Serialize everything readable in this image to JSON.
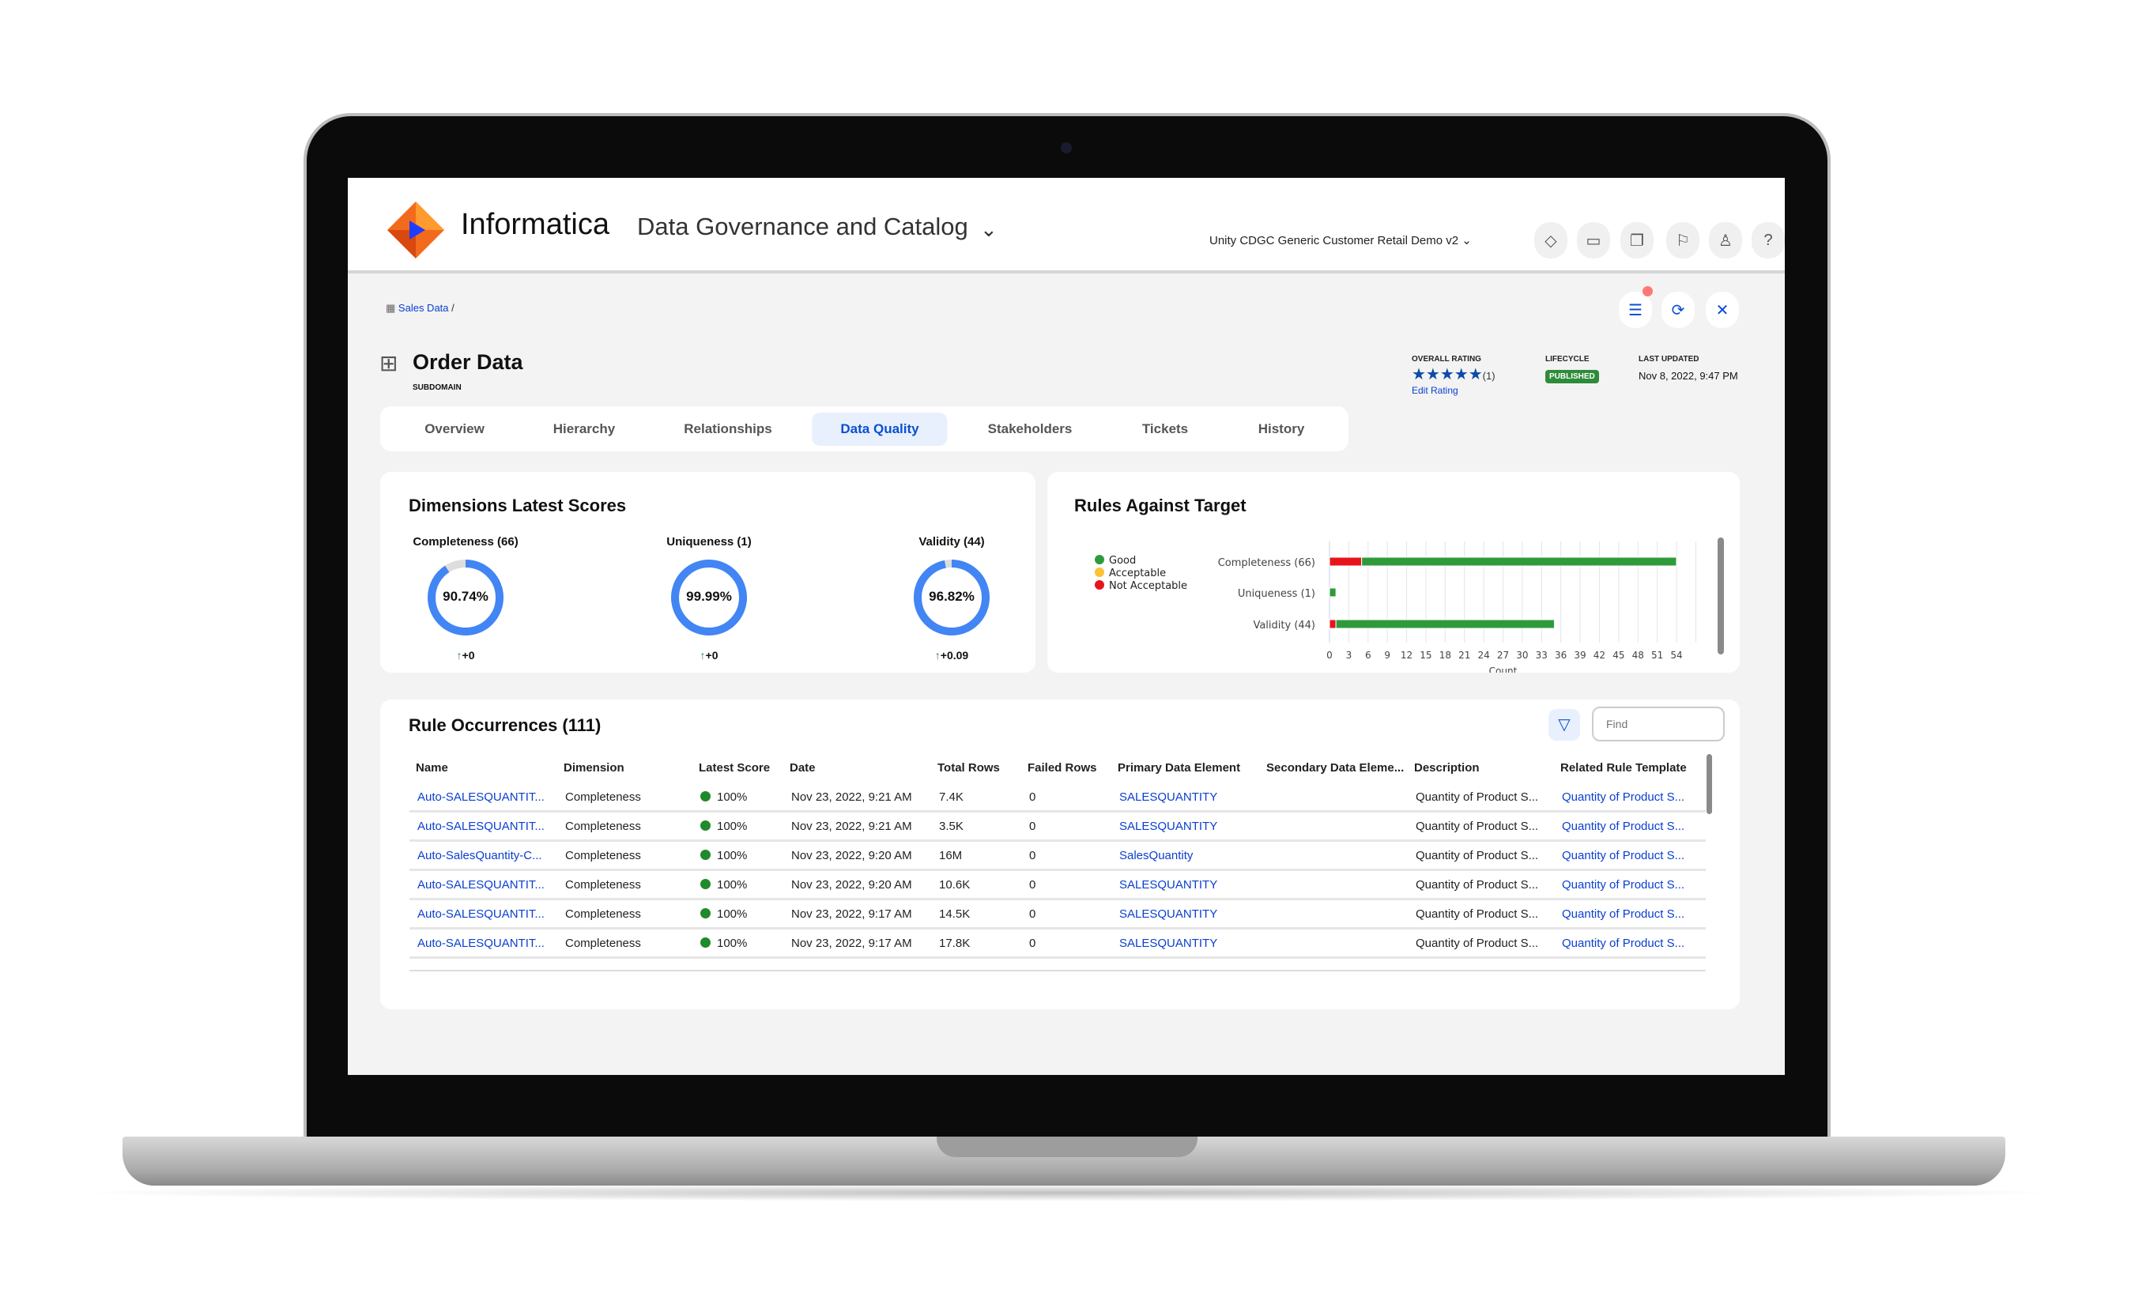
{
  "header": {
    "brand": "Informatica",
    "product": "Data Governance and Catalog",
    "workspace": "Unity CDGC Generic Customer Retail Demo v2",
    "icons": [
      "tag-icon",
      "inbox-icon",
      "copy-icon",
      "flag-icon",
      "user-icon",
      "help-icon"
    ]
  },
  "breadcrumb": {
    "item": "Sales Data",
    "sep": "/"
  },
  "asset": {
    "title": "Order Data",
    "type": "SUBDOMAIN"
  },
  "meta": {
    "rating_label": "OVERALL RATING",
    "stars": 5,
    "rating_count": "(1)",
    "edit_rating": "Edit Rating",
    "lifecycle_label": "LIFECYCLE",
    "lifecycle": "PUBLISHED",
    "updated_label": "LAST UPDATED",
    "updated": "Nov 8, 2022, 9:47 PM"
  },
  "tabs": [
    "Overview",
    "Hierarchy",
    "Relationships",
    "Data Quality",
    "Stakeholders",
    "Tickets",
    "History"
  ],
  "active_tab": "Data Quality",
  "dimensions": {
    "title": "Dimensions Latest Scores",
    "items": [
      {
        "label": "Completeness (66)",
        "score": 90.74,
        "score_text": "90.74%",
        "delta": "+0"
      },
      {
        "label": "Uniqueness (1)",
        "score": 99.99,
        "score_text": "99.99%",
        "delta": "+0"
      },
      {
        "label": "Validity (44)",
        "score": 96.82,
        "score_text": "96.82%",
        "delta": "+0.09"
      }
    ]
  },
  "chart_data": {
    "type": "bar",
    "orientation": "horizontal",
    "stacked": true,
    "title": "Rules Against Target",
    "xlabel": "Count",
    "categories": [
      "Completeness (66)",
      "Uniqueness (1)",
      "Validity (44)"
    ],
    "series": [
      {
        "name": "Not Acceptable",
        "color": "#e8141b",
        "values": [
          5,
          0,
          1
        ]
      },
      {
        "name": "Acceptable",
        "color": "#fcc234",
        "values": [
          0,
          0,
          0
        ]
      },
      {
        "name": "Good",
        "color": "#2f9a3b",
        "values": [
          49,
          1,
          34
        ]
      }
    ],
    "legend": [
      "Good",
      "Acceptable",
      "Not Acceptable"
    ],
    "legend_colors": [
      "#2f9a3b",
      "#fcc234",
      "#e8141b"
    ],
    "legend_position": "left",
    "xticks": [
      0,
      3,
      6,
      9,
      12,
      15,
      18,
      21,
      24,
      27,
      30,
      33,
      36,
      39,
      42,
      45,
      48,
      51,
      54
    ],
    "xlim": [
      0,
      57
    ],
    "grid": true
  },
  "occurrences": {
    "title": "Rule Occurrences (111)",
    "find_placeholder": "Find",
    "columns": [
      "Name",
      "Dimension",
      "Latest Score",
      "Date",
      "Total Rows",
      "Failed Rows",
      "Primary Data Element",
      "Secondary Data Eleme...",
      "Description",
      "Related Rule Template"
    ],
    "rows": [
      [
        "Auto-SALESQUANTIT...",
        "Completeness",
        "100%",
        "Nov 23, 2022, 9:21 AM",
        "7.4K",
        "0",
        "SALESQUANTITY",
        "",
        "Quantity of Product S...",
        "Quantity of Product S..."
      ],
      [
        "Auto-SALESQUANTIT...",
        "Completeness",
        "100%",
        "Nov 23, 2022, 9:21 AM",
        "3.5K",
        "0",
        "SALESQUANTITY",
        "",
        "Quantity of Product S...",
        "Quantity of Product S..."
      ],
      [
        "Auto-SalesQuantity-C...",
        "Completeness",
        "100%",
        "Nov 23, 2022, 9:20 AM",
        "16M",
        "0",
        "SalesQuantity",
        "",
        "Quantity of Product S...",
        "Quantity of Product S..."
      ],
      [
        "Auto-SALESQUANTIT...",
        "Completeness",
        "100%",
        "Nov 23, 2022, 9:20 AM",
        "10.6K",
        "0",
        "SALESQUANTITY",
        "",
        "Quantity of Product S...",
        "Quantity of Product S..."
      ],
      [
        "Auto-SALESQUANTIT...",
        "Completeness",
        "100%",
        "Nov 23, 2022, 9:17 AM",
        "14.5K",
        "0",
        "SALESQUANTITY",
        "",
        "Quantity of Product S...",
        "Quantity of Product S..."
      ],
      [
        "Auto-SALESQUANTIT...",
        "Completeness",
        "100%",
        "Nov 23, 2022, 9:17 AM",
        "17.8K",
        "0",
        "SALESQUANTITY",
        "",
        "Quantity of Product S...",
        "Quantity of Product S..."
      ]
    ]
  },
  "colors": {
    "accent": "#0a4fd0",
    "donut": "#4285f4",
    "published": "#2e8b3a"
  }
}
